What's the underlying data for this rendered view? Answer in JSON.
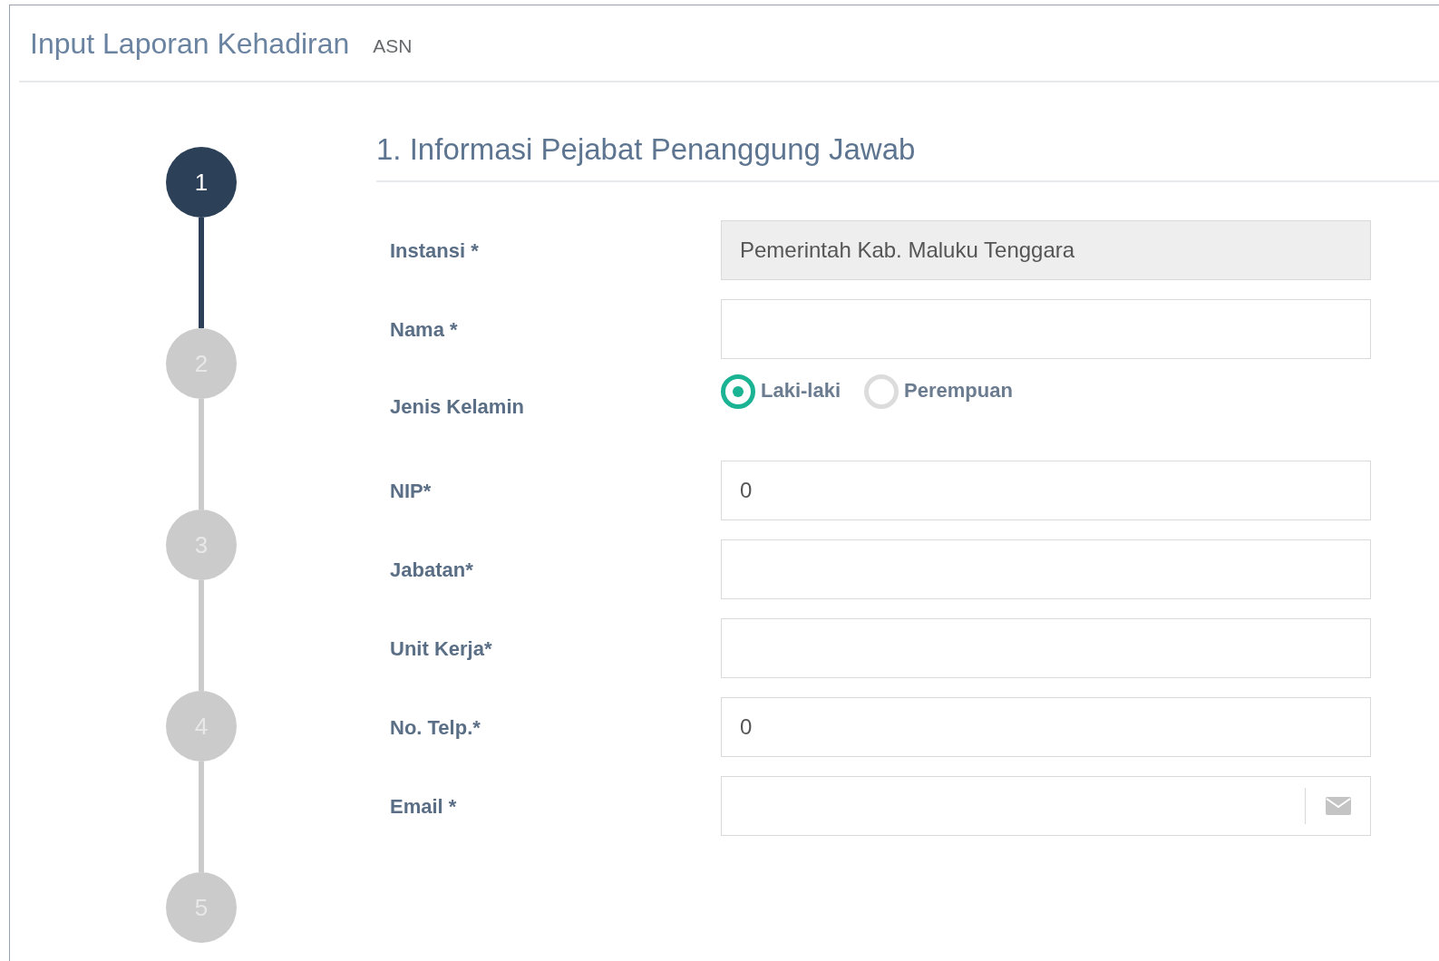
{
  "header": {
    "title": "Input Laporan Kehadiran",
    "subtitle": "ASN"
  },
  "steps": [
    {
      "label": "1",
      "selected": true
    },
    {
      "label": "2",
      "selected": false
    },
    {
      "label": "3",
      "selected": false
    },
    {
      "label": "4",
      "selected": false
    },
    {
      "label": "5",
      "selected": false
    }
  ],
  "section": {
    "title": "1. Informasi Pejabat Penanggung Jawab"
  },
  "fields": [
    {
      "kind": "text",
      "label": "Instansi *",
      "value": "Pemerintah Kab. Maluku Tenggara",
      "disabled": true
    },
    {
      "kind": "text",
      "label": "Nama *",
      "disabled": false
    },
    {
      "kind": "radio",
      "label": "Jenis Kelamin",
      "options": [
        {
          "label": "Laki-laki",
          "selected": true
        },
        {
          "label": "Perempuan",
          "selected": false
        }
      ]
    },
    {
      "kind": "text",
      "label": "NIP*",
      "value": "0",
      "disabled": false
    },
    {
      "kind": "text",
      "label": "Jabatan*",
      "disabled": false
    },
    {
      "kind": "text",
      "label": "Unit Kerja*",
      "disabled": false
    },
    {
      "kind": "text",
      "label": "No. Telp.*",
      "value": "0",
      "disabled": false
    },
    {
      "kind": "email",
      "label": "Email *"
    }
  ]
}
